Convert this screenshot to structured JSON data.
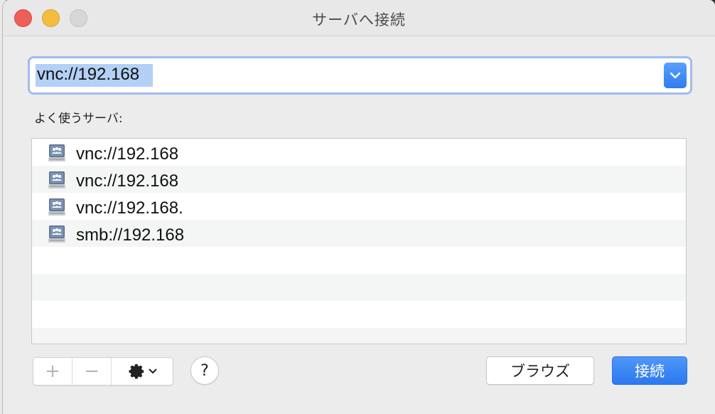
{
  "window": {
    "title": "サーバへ接続"
  },
  "address": {
    "value": "vnc://192.168"
  },
  "favorites": {
    "label": "よく使うサーバ:",
    "items": [
      {
        "label": "vnc://192.168",
        "icon": "server-icon"
      },
      {
        "label": "vnc://192.168",
        "icon": "server-icon"
      },
      {
        "label": "vnc://192.168.",
        "icon": "server-icon"
      },
      {
        "label": "smb://192.168",
        "icon": "server-icon"
      }
    ]
  },
  "toolbar": {
    "add_label": "+",
    "remove_label": "−",
    "help_label": "?",
    "browse_label": "ブラウズ",
    "connect_label": "接続"
  },
  "colors": {
    "accent": "#2e7bf2",
    "selection": "#b3d0f6",
    "focus_ring": "#9fbdf0"
  }
}
